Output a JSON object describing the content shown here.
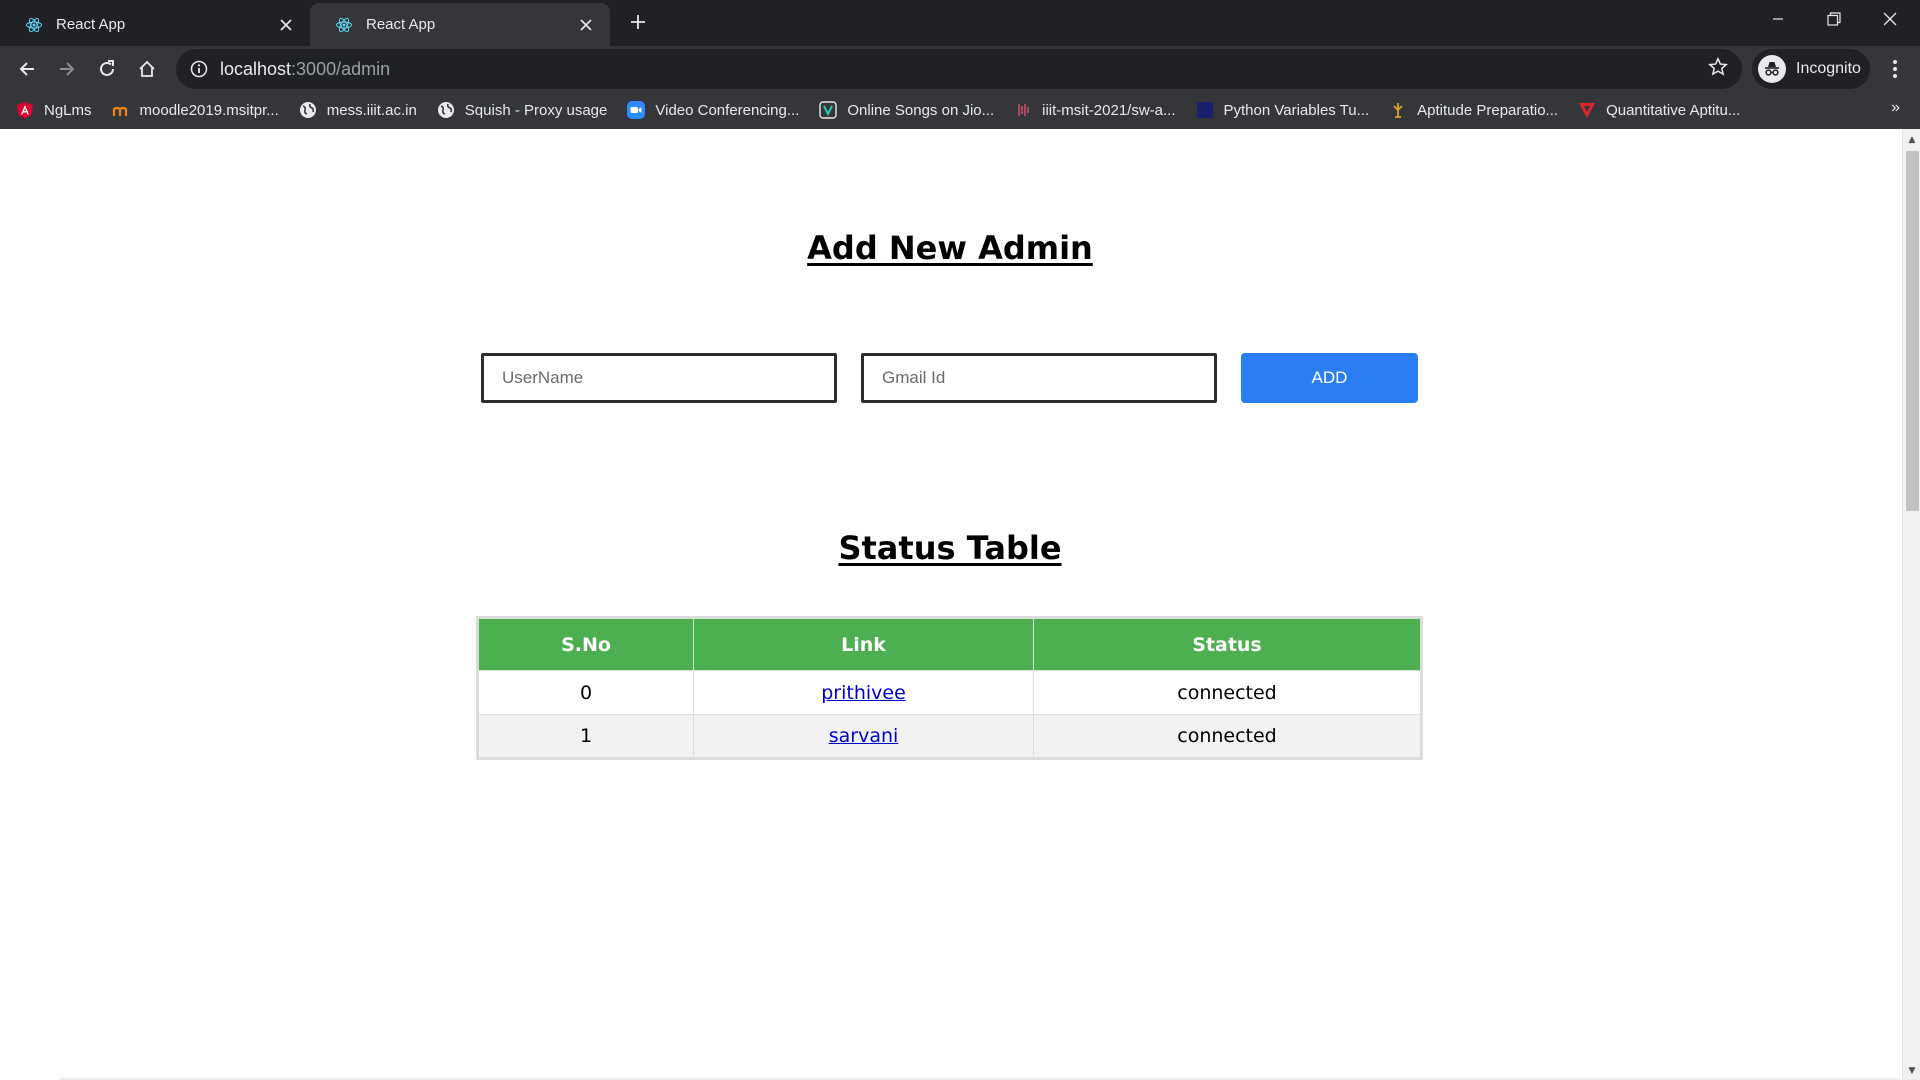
{
  "browser": {
    "tabs": [
      {
        "title": "React App",
        "active": false
      },
      {
        "title": "React App",
        "active": true
      }
    ],
    "url": {
      "host": "localhost",
      "path": ":3000/admin"
    },
    "profile_label": "Incognito",
    "bookmarks": [
      {
        "label": "NgLms",
        "icon": "angular-icon",
        "color": "#dd0031"
      },
      {
        "label": "moodle2019.msitpr...",
        "icon": "moodle-icon",
        "color": "#f98012"
      },
      {
        "label": "mess.iiit.ac.in",
        "icon": "globe-icon",
        "color": "#e8eaed"
      },
      {
        "label": "Squish - Proxy usage",
        "icon": "globe-icon",
        "color": "#e8eaed"
      },
      {
        "label": "Video Conferencing...",
        "icon": "zoom-icon",
        "color": "#2d8cff"
      },
      {
        "label": "Online Songs on Jio...",
        "icon": "jiosaavn-icon",
        "color": "#2bc5b4"
      },
      {
        "label": "iiit-msit-2021/sw-a...",
        "icon": "gitlab-icon",
        "color": "#fc6d26"
      },
      {
        "label": "Python Variables Tu...",
        "icon": "tutorial-icon",
        "color": "#1a1f6e"
      },
      {
        "label": "Aptitude Preparatio...",
        "icon": "indiabix-icon",
        "color": "#e0a030"
      },
      {
        "label": "Quantitative Aptitu...",
        "icon": "vertex-icon",
        "color": "#e0262d"
      }
    ]
  },
  "page": {
    "add_heading": "Add New Admin",
    "username_placeholder": "UserName",
    "gmail_placeholder": "Gmail Id",
    "add_button": "ADD",
    "table_heading": "Status Table",
    "table": {
      "columns": [
        "S.No",
        "Link",
        "Status"
      ],
      "rows": [
        {
          "sno": "0",
          "link": "prithivee",
          "status": "connected"
        },
        {
          "sno": "1",
          "link": "sarvani",
          "status": "connected"
        }
      ]
    }
  },
  "colors": {
    "header_green": "#4caf50",
    "button_blue": "#2a7ef4",
    "link_blue": "#0000cc"
  }
}
